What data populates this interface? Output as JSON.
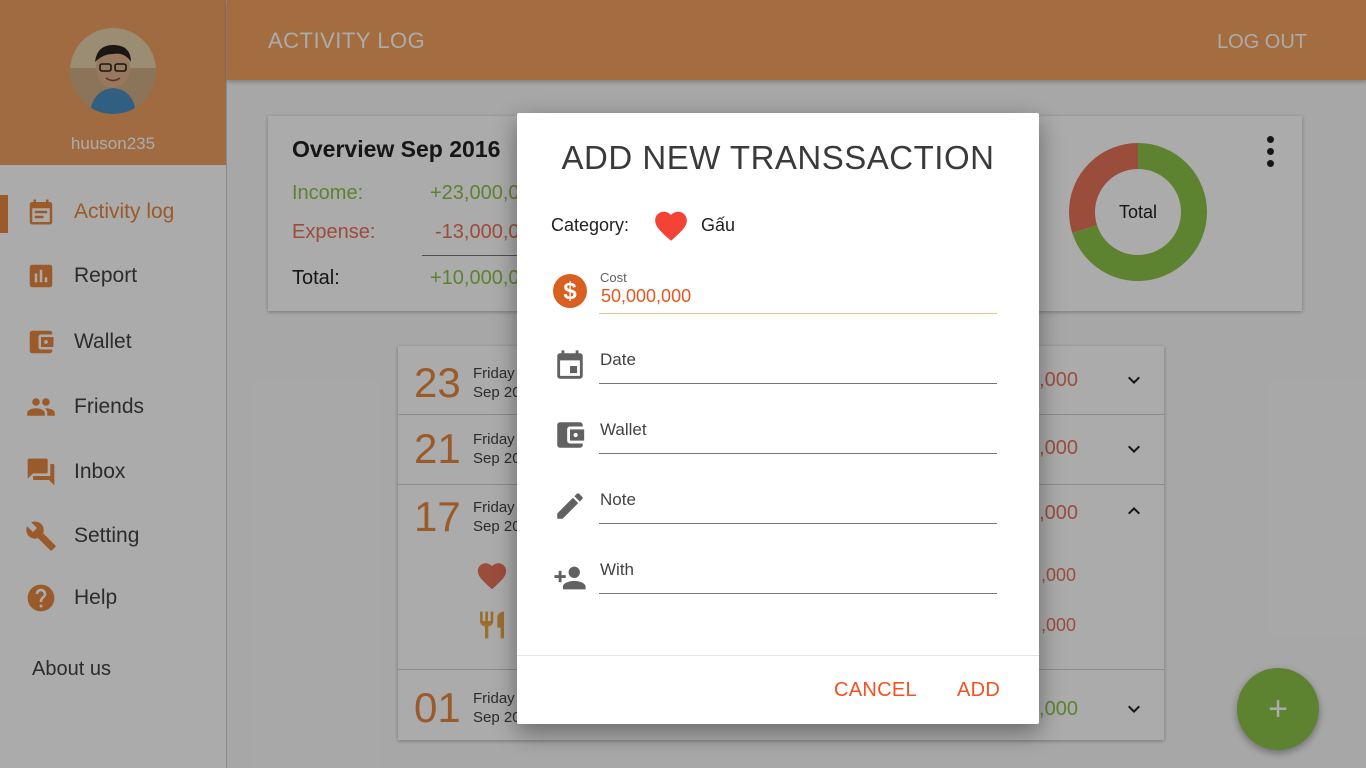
{
  "sidebar": {
    "username": "huuson235",
    "items": [
      {
        "label": "Activity log",
        "icon": "calendar-icon"
      },
      {
        "label": "Report",
        "icon": "bar-chart-icon"
      },
      {
        "label": "Wallet",
        "icon": "wallet-icon"
      },
      {
        "label": "Friends",
        "icon": "people-icon"
      },
      {
        "label": "Inbox",
        "icon": "forum-icon"
      },
      {
        "label": "Setting",
        "icon": "wrench-icon"
      },
      {
        "label": "Help",
        "icon": "help-icon"
      }
    ],
    "about": "About us"
  },
  "topbar": {
    "title": "ACTIVITY LOG",
    "logout": "LOG OUT"
  },
  "overview": {
    "title": "Overview Sep 2016",
    "income_label": "Income:",
    "income_value": "+23,000,0",
    "expense_label": "Expense:",
    "expense_value": "-13,000,0",
    "total_label": "Total:",
    "total_value": "+10,000,0",
    "donut_label": "Total",
    "donut_income_fraction": 0.7,
    "donut_expense_fraction": 0.3
  },
  "days": [
    {
      "num": "23",
      "dow": "Friday",
      "date": "Sep 20",
      "amount": ",000"
    },
    {
      "num": "21",
      "dow": "Friday",
      "date": "Sep 20",
      "amount": ",000"
    },
    {
      "num": "17",
      "dow": "Friday",
      "date": "Sep 20",
      "amount": ",000",
      "sub": [
        ",000",
        ",000"
      ]
    },
    {
      "num": "01",
      "dow": "Friday",
      "date": "Sep 20",
      "amount": "0,000"
    }
  ],
  "fab": "+",
  "dialog": {
    "title": "ADD NEW  TRANSSACTION",
    "category_label": "Category:",
    "category_name": "Gấu",
    "cost_label": "Cost",
    "cost_value": "50,000,000",
    "date_placeholder": "Date",
    "wallet_placeholder": "Wallet",
    "note_placeholder": "Note",
    "with_placeholder": "With",
    "cancel": "CANCEL",
    "add": "ADD"
  },
  "colors": {
    "accent": "#f4a35e",
    "active": "#e8863e",
    "income": "#8bc34a",
    "expense": "#e8735a",
    "button": "#f4511e"
  }
}
